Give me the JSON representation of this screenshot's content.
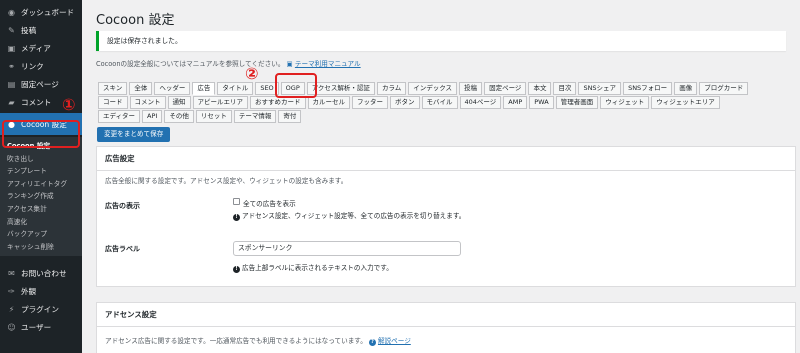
{
  "sidebar": {
    "items": [
      {
        "label": "ダッシュボード",
        "icon": "dashboard-icon",
        "glyph": "◉"
      },
      {
        "label": "投稿",
        "icon": "pin-icon",
        "glyph": "✎"
      },
      {
        "label": "メディア",
        "icon": "media-icon",
        "glyph": "▣"
      },
      {
        "label": "リンク",
        "icon": "link-icon",
        "glyph": "⚭"
      },
      {
        "label": "固定ページ",
        "icon": "page-icon",
        "glyph": "▤"
      },
      {
        "label": "コメント",
        "icon": "comment-icon",
        "glyph": "▰"
      }
    ],
    "current": {
      "label": "Cocoon 設定",
      "icon": "cocoon-icon",
      "glyph": "●"
    },
    "submenu": [
      "Cocoon 設定",
      "吹き出し",
      "テンプレート",
      "アフィリエイトタグ",
      "ランキング作成",
      "アクセス集計",
      "高速化",
      "バックアップ",
      "キャッシュ削除"
    ],
    "after": [
      {
        "label": "お問い合わせ",
        "icon": "mail-icon",
        "glyph": "✉"
      },
      {
        "label": "外観",
        "icon": "appearance-icon",
        "glyph": "✑"
      },
      {
        "label": "プラグイン",
        "icon": "plugin-icon",
        "glyph": "⚡"
      },
      {
        "label": "ユーザー",
        "icon": "user-icon",
        "glyph": "☺"
      }
    ]
  },
  "annotations": {
    "circle1": "①",
    "circle2": "②"
  },
  "page": {
    "title": "Cocoon 設定",
    "notice": "設定は保存されました。",
    "manual_text": "Cocoonの設定全般についてはマニュアルを参照してください。",
    "manual_link": "テーマ利用マニュアル",
    "save_button": "変更をまとめて保存"
  },
  "tabs": {
    "row1": [
      "スキン",
      "全体",
      "ヘッダー",
      "広告",
      "タイトル",
      "SEO",
      "OGP",
      "アクセス解析・認証",
      "カラム",
      "インデックス",
      "投稿",
      "固定ページ",
      "本文",
      "目次",
      "SNSシェア",
      "SNSフォロー",
      "画像",
      "ブログカード"
    ],
    "row2": [
      "コード",
      "コメント",
      "通知",
      "アピールエリア",
      "おすすめカード",
      "カルーセル",
      "フッター",
      "ボタン",
      "モバイル",
      "404ページ",
      "AMP",
      "PWA",
      "管理者画面",
      "ウィジェット",
      "ウィジェットエリア"
    ],
    "row3": [
      "エディター",
      "API",
      "その他",
      "リセット",
      "テーマ情報",
      "寄付"
    ],
    "active": "広告"
  },
  "ads_panel": {
    "title": "広告設定",
    "description": "広告全般に関する設定です。アドセンス設定や、ウィジェットの設定も含みます。",
    "display_label": "広告の表示",
    "display_checkbox": "全ての広告を表示",
    "display_help": "アドセンス設定、ウィジェット設定等、全ての広告の表示を切り替えます。",
    "ad_label_label": "広告ラベル",
    "ad_label_value": "スポンサーリンク",
    "ad_label_help": "広告上部ラベルに表示されるテキストの入力です。"
  },
  "adsense_panel": {
    "title": "アドセンス設定",
    "description": "アドセンス広告に関する設定です。一応通常広告でも利用できるようにはなっています。",
    "link": "解説ページ"
  },
  "colors": {
    "accent": "#2271b1",
    "sidebar": "#1d2327",
    "annotation": "#e02020",
    "notice": "#00a32a"
  }
}
